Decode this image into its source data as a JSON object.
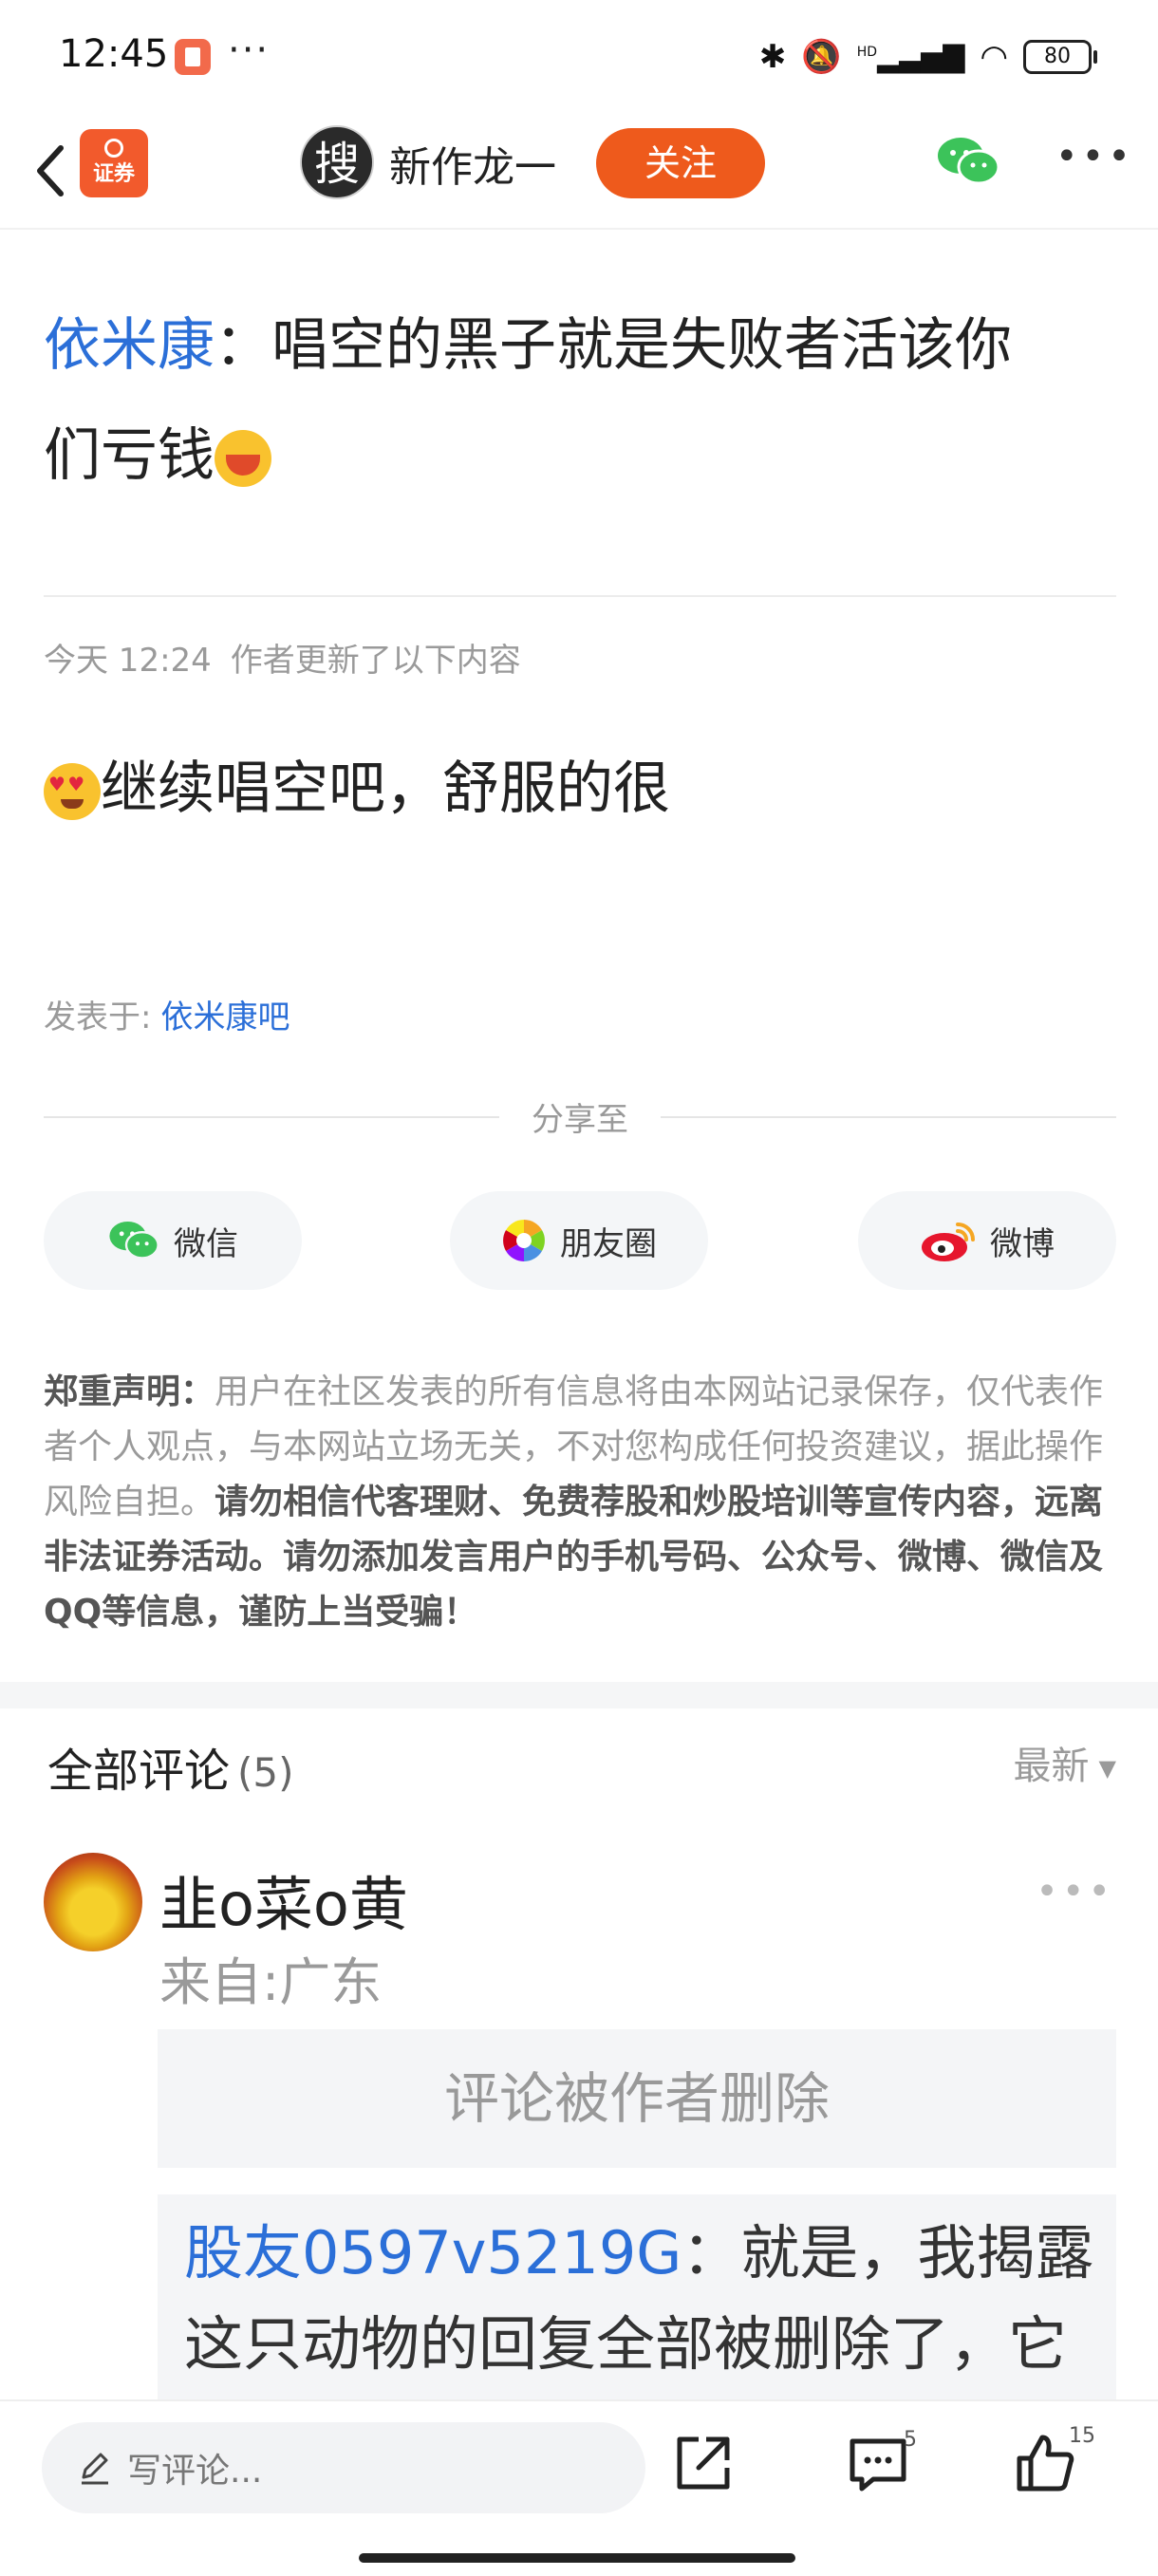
{
  "status_bar": {
    "time": "12:45",
    "dots": "···",
    "network": "HD",
    "battery": "80"
  },
  "header": {
    "app_logo_text": "证券",
    "author_avatar_char": "搜",
    "author_name": "新作龙一",
    "follow_label": "关注"
  },
  "post": {
    "title_user": "依米康",
    "title_sep": "：",
    "title_text_line1": "唱空的黑子就是失败者活该你",
    "title_text_line2": "们亏钱",
    "update_time": "今天 12:24",
    "update_note": "作者更新了以下内容",
    "update_body": "继续唱空吧，舒服的很",
    "posted_in_label": "发表于:",
    "posted_in_bar": "依米康吧"
  },
  "share": {
    "title": "分享至",
    "wechat": "微信",
    "moments": "朋友圈",
    "weibo": "微博"
  },
  "disclaimer": {
    "label": "郑重声明：",
    "normal_text": "用户在社区发表的所有信息将由本网站记录保存，仅代表作者个人观点，与本网站立场无关，不对您构成任何投资建议，据此操作风险自担。",
    "strong_text": "请勿相信代客理财、免费荐股和炒股培训等宣传内容，远离非法证券活动。请勿添加发言用户的手机号码、公众号、微博、微信及QQ等信息，谨防上当受骗！"
  },
  "comments": {
    "title": "全部评论",
    "count": "(5)",
    "sort_label": "最新",
    "items": [
      {
        "name": "韭o菜o黄",
        "location": "来自:广东",
        "deleted_text": "评论被作者删除",
        "reply_user": "股友0597v5219G",
        "reply_text": "：就是，我揭露这只动物的回复全部被删除了，它"
      }
    ]
  },
  "bottom_bar": {
    "comment_placeholder": "写评论...",
    "comment_count": "5",
    "like_count": "15"
  }
}
